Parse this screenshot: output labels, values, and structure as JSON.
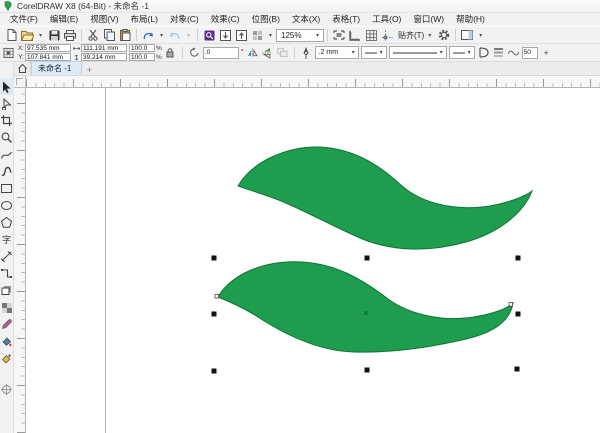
{
  "window": {
    "title": "CorelDRAW X8 (64-Bit) - 未命名 -1"
  },
  "menubar": {
    "items": [
      "文件(F)",
      "编辑(E)",
      "视图(V)",
      "布局(L)",
      "对象(C)",
      "效果(C)",
      "位图(B)",
      "文本(X)",
      "表格(T)",
      "工具(O)",
      "窗口(W)",
      "帮助(H)"
    ]
  },
  "toolbar": {
    "zoom_level": "125%",
    "snap_label": "贴齐(T)",
    "dropdown_caret": "▾",
    "icons": [
      "new-document",
      "open",
      "save",
      "print",
      "cut",
      "copy",
      "paste",
      "undo",
      "redo",
      "search-content",
      "import",
      "export",
      "application-launcher",
      "full-screen-preview",
      "show-rulers",
      "show-grid",
      "show-guidelines",
      "snap-to",
      "options",
      "dockers"
    ]
  },
  "propbar": {
    "x_label": "X:",
    "y_label": "Y:",
    "x_value": "97.535 mm",
    "y_value": "107.841 mm",
    "width_value": "111.191 mm",
    "height_value": "39.214 mm",
    "scale_x_value": "100.0",
    "scale_y_value": "100.0",
    "percent": "%",
    "rotation_value": ".0",
    "degree_symbol": "°",
    "outline_width_value": ".2 mm",
    "smoothing_value": "50",
    "smoothing_plus": "+",
    "icons": [
      "object-position",
      "size",
      "scale-factor",
      "lock-ratio",
      "rotation-angle",
      "mirror-horizontal",
      "mirror-vertical",
      "outline-pen",
      "arrowhead-start",
      "line-style",
      "arrowhead-end",
      "wrap-paragraph-text",
      "object-properties",
      "smoothing"
    ]
  },
  "document_tabs": {
    "active_tab": "未命名 -1",
    "new_tab_label": "+",
    "home_icon": "welcome-screen-home"
  },
  "toolbox": {
    "tools": [
      "pick",
      "shape",
      "crop",
      "zoom",
      "freehand",
      "artistic-media",
      "rectangle",
      "ellipse",
      "polygon",
      "text",
      "parallel-dimension",
      "connector",
      "drop-shadow",
      "transparency",
      "color-eyedropper",
      "interactive-fill",
      "smart-fill",
      "fine-position"
    ],
    "text_tool_glyph": "字"
  },
  "canvas": {
    "shapes": [
      "upper-green-wave-leaf",
      "lower-green-wave-leaf-selected"
    ],
    "shape_fill": "#1f9d4e",
    "shape_stroke": "#0e7437",
    "selection_handle_color": "#111111",
    "page_edge_color": "#b3b3b3",
    "zoom_percent_shown_in_toolbar": "125%"
  }
}
